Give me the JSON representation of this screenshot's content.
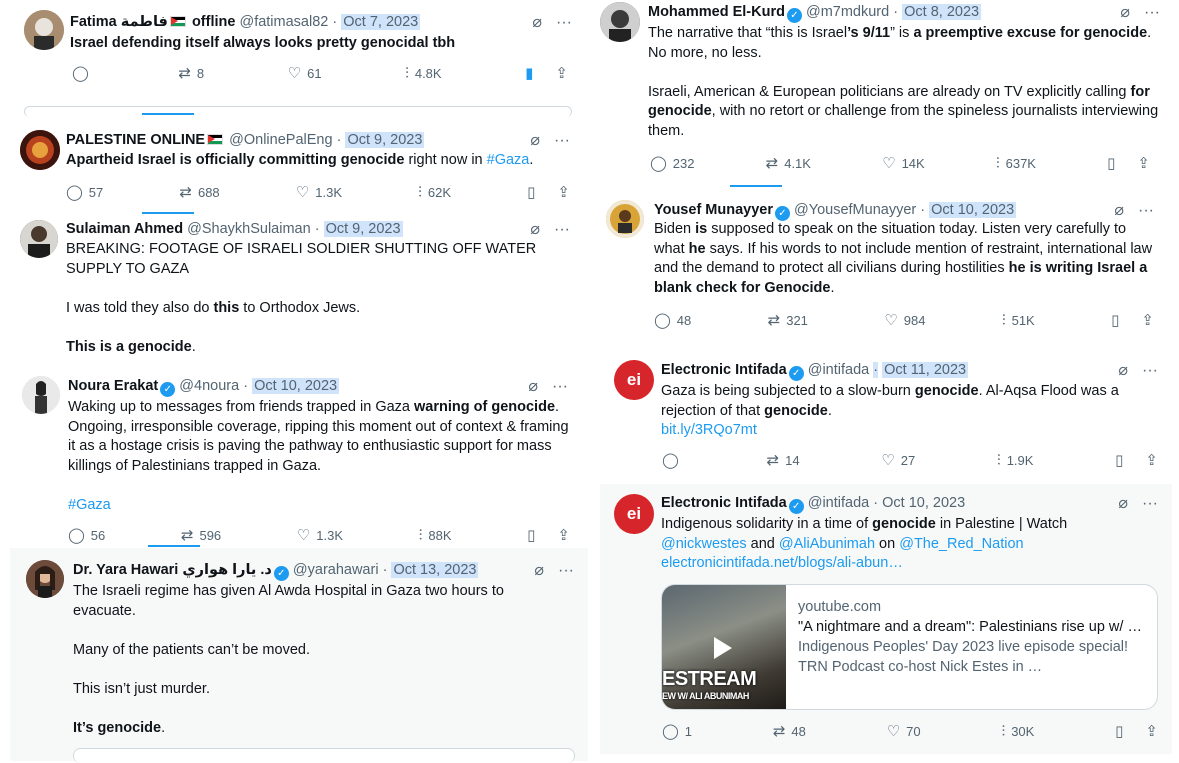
{
  "colors": {
    "accent": "#1d9bf0",
    "muted": "#536471",
    "date_highlight": "#cfe3fb"
  },
  "tweets": {
    "fatima": {
      "name": "Fatima",
      "arabic": "فاطمة",
      "status": "offline",
      "handle": "@fatimasal82",
      "date": "Oct 7, 2023",
      "text": "Israel defending itself always looks pretty genocidal tbh",
      "actions": {
        "reply": "",
        "retweet": "8",
        "like": "61",
        "views": "4.8K"
      }
    },
    "palestine_online": {
      "name": "PALESTINE ONLINE",
      "handle": "@OnlinePalEng",
      "date": "Oct 9, 2023",
      "text_bold": "Apartheid Israel is officially committing genocide",
      "text_rest": " right now in ",
      "hashtag": "#Gaza",
      "text_end": ".",
      "actions": {
        "reply": "57",
        "retweet": "688",
        "like": "1.3K",
        "views": "62K"
      }
    },
    "sulaiman": {
      "name": "Sulaiman Ahmed",
      "handle": "@ShaykhSulaiman",
      "date": "Oct 9, 2023",
      "p1": "BREAKING: FOOTAGE OF ISRAELI SOLDIER SHUTTING OFF WATER SUPPLY TO GAZA",
      "p2_start": "I was told they also do ",
      "p2_bold": "this",
      "p2_end": " to Orthodox Jews.",
      "p3_bold": "This is a genocide",
      "p3_end": "."
    },
    "noura": {
      "name": "Noura Erakat",
      "handle": "@4noura",
      "date": "Oct 10, 2023",
      "p1_start": "Waking up to messages from friends trapped in Gaza ",
      "p1_bold": "warning of genocide",
      "p1_end": ". Ongoing, irresponsible coverage, ripping this moment out of context & framing it as a hostage crisis is paving the pathway to enthusiastic support for mass killings of Palestinians trapped in Gaza.",
      "hashtag": "#Gaza",
      "actions": {
        "reply": "56",
        "retweet": "596",
        "like": "1.3K",
        "views": "88K"
      }
    },
    "yara": {
      "name": "Dr. Yara Hawari",
      "arabic": "د. يارا هواري",
      "handle": "@yarahawari",
      "date": "Oct 13, 2023",
      "p1": "The Israeli regime has given Al Awda Hospital in Gaza two hours to evacuate.",
      "p2": "Many of the patients can’t be moved.",
      "p3": "This isn’t just murder.",
      "p4_bold": "It’s genocide",
      "p4_end": "."
    },
    "mohammed": {
      "name": "Mohammed El-Kurd",
      "handle": "@m7mdkurd",
      "date": "Oct 8, 2023",
      "p1_start": "The narrative that “this is Israel",
      "p1_bold1": "’s 9/11",
      "p1_mid": "” is ",
      "p1_bold2": "a preemptive excuse for genocide",
      "p1_end": ". No more, no less.",
      "p2_start": "Israeli, American & European politicians are already on TV explicitly calling ",
      "p2_bold": "for genocide",
      "p2_end": ", with no retort or challenge from the spineless journalists interviewing them.",
      "actions": {
        "reply": "232",
        "retweet": "4.1K",
        "like": "14K",
        "views": "637K"
      }
    },
    "yousef": {
      "name": "Yousef Munayyer",
      "handle": "@YousefMunayyer",
      "date": "Oct 10, 2023",
      "t1": "Biden ",
      "t1b": "is",
      "t2": " supposed to speak on the situation today. Listen very carefully to what ",
      "t2b": "he",
      "t3": " says. If his words to not include mention of restraint, international law and the demand to protect all civilians during hostilities ",
      "t3b": "he is writing Israel a blank check for Genocide",
      "t4": ".",
      "actions": {
        "reply": "48",
        "retweet": "321",
        "like": "984",
        "views": "51K"
      }
    },
    "ei1": {
      "name": "Electronic Intifada",
      "handle": "@intifada",
      "date": "Oct 11, 2023",
      "t1": "Gaza is being subjected to a slow-burn ",
      "t1b": "genocide",
      "t2": ". Al-Aqsa Flood was a rejection of that ",
      "t2b": "genocide",
      "t3": ".",
      "link": "bit.ly/3RQo7mt",
      "actions": {
        "reply": "",
        "retweet": "14",
        "like": "27",
        "views": "1.9K"
      }
    },
    "ei2": {
      "name": "Electronic Intifada",
      "handle": "@intifada",
      "date": "Oct 10, 2023",
      "t1": "Indigenous solidarity in a time of ",
      "t1b": "genocide",
      "t2": " in Palestine | Watch ",
      "m1": "@nickwestes",
      "and": " and ",
      "m2": "@AliAbunimah",
      "on": " on ",
      "m3": "@The_Red_Nation",
      "link": "electronicintifada.net/blogs/ali-abun…",
      "card": {
        "domain": "youtube.com",
        "title": "\"A nightmare and a dream\": Palestinians rise up w/ …",
        "desc": "Indigenous Peoples' Day 2023 live episode special! TRN Podcast co-host Nick Estes in …",
        "thumb_text": "ESTREAM",
        "thumb_sub": "EW W/ ALI ABUNIMAH"
      },
      "actions": {
        "reply": "1",
        "retweet": "48",
        "like": "70",
        "views": "30K"
      }
    }
  },
  "icons": {
    "reply": "reply-icon",
    "retweet": "retweet-icon",
    "like": "heart-icon",
    "views": "views-icon",
    "bookmark": "bookmark-icon",
    "share": "share-icon",
    "grok": "grok-icon",
    "more": "more-icon"
  }
}
